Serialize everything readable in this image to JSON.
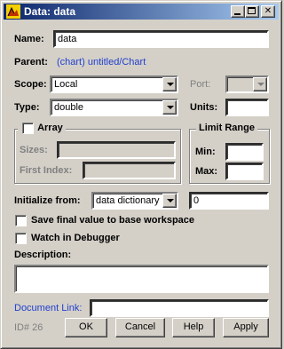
{
  "window": {
    "title": "Data: data"
  },
  "name": {
    "label": "Name:",
    "value": "data"
  },
  "parent": {
    "label": "Parent:",
    "value": "(chart) untitled/Chart"
  },
  "scope": {
    "label": "Scope:",
    "value": "Local"
  },
  "port": {
    "label": "Port:",
    "value": ""
  },
  "type": {
    "label": "Type:",
    "value": "double"
  },
  "units": {
    "label": "Units:",
    "value": ""
  },
  "array": {
    "label": "Array",
    "checked": false,
    "sizes_label": "Sizes:",
    "first_index_label": "First Index:"
  },
  "limit_range": {
    "label": "Limit Range",
    "min_label": "Min:",
    "max_label": "Max:"
  },
  "initialize": {
    "label": "Initialize from:",
    "source": "data dictionary",
    "value": "0"
  },
  "save_final": {
    "label": "Save final value to base workspace",
    "checked": false
  },
  "watch": {
    "label": "Watch in Debugger",
    "checked": false
  },
  "description": {
    "label": "Description:",
    "value": ""
  },
  "document_link": {
    "label": "Document Link:",
    "value": ""
  },
  "id_text": "ID# 26",
  "buttons": {
    "ok": "OK",
    "cancel": "Cancel",
    "help": "Help",
    "apply": "Apply"
  },
  "colors": {
    "titlebar_start": "#0a246a",
    "titlebar_end": "#a6caf0",
    "face": "#d4d0c8",
    "link": "#1f3fcf"
  }
}
